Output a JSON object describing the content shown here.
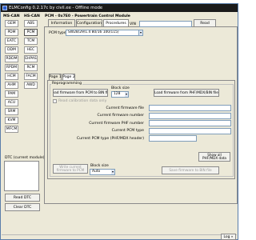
{
  "window": {
    "title": "ELMConfig 0.2.17c by civil.ee - Offline mode"
  },
  "sidebar": {
    "header_left": "MS-CAN",
    "header_right": "HS-CAN",
    "ms_items": [
      "GEM",
      "PDM",
      "EATC",
      "DDM",
      "RDDM",
      "RPDM",
      "HCM",
      "AHM",
      "PAM",
      "ACU",
      "SRM",
      "KVM",
      "MFCM"
    ],
    "hs_items": [
      "ABS",
      "PCM",
      "TCM",
      "HEC",
      "EHPAS",
      "RCM",
      "FACM",
      "AWD"
    ],
    "dtc_label": "DTC (current module)",
    "read_dtc": "Read DTC",
    "clear_dtc": "Clear DTC"
  },
  "module": {
    "title": "PCM - 0x7E0 - Powertrain Control Module",
    "tabs": [
      "Information",
      "Configuration",
      "Procedures"
    ],
    "active_tab": 2,
    "vin_label": "VIN",
    "vin_value": "",
    "read_label": "Read",
    "pcm_type_label": "PCM type",
    "pcm_type_value": "SW28/29/1.4 80/16 100/115)"
  },
  "pages": {
    "tabs": [
      "Page 1",
      "Page 2"
    ],
    "active": 1
  },
  "reprogramming": {
    "group_label": "Reprogramming",
    "read_firmware_btn": "Read firmware from PCM to BIN file",
    "block_size_label": "Block size",
    "block_size_value": "128",
    "load_firmware_btn": "Load firmware from PHF/MDX/BIN file",
    "read_calibration_label": "Read calibration data only",
    "fields": [
      {
        "label": "Current firmware file",
        "value": ""
      },
      {
        "label": "Current firmware number",
        "value": ""
      },
      {
        "label": "Current firmware PHF number",
        "value": ""
      },
      {
        "label": "Current PCM type",
        "value": ""
      },
      {
        "label": "Current PCM type (PHF/MDX header)",
        "value": ""
      }
    ],
    "show_all_label": "Show all PHF/MDX data",
    "write_btn": "Write current firmware to PCM",
    "block_size2_label": "Block size",
    "block_size2_value": "Auto",
    "save_btn": "Save firmware to BIN file"
  },
  "status": {
    "log_label": "Log »"
  }
}
